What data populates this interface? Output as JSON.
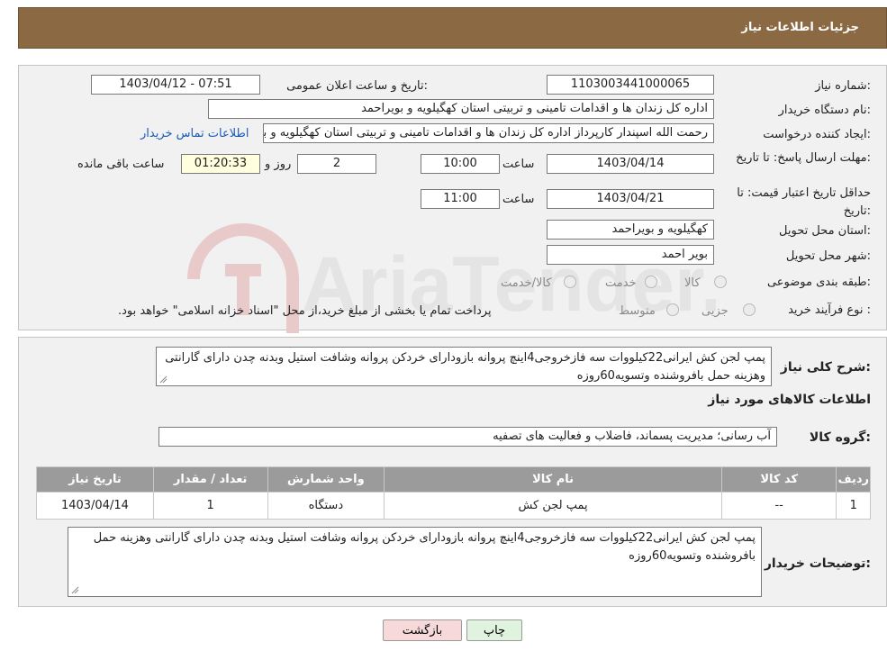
{
  "header": {
    "title": "جزئیات اطلاعات نیاز"
  },
  "form": {
    "need_number_label": "شماره نیاز:",
    "need_number": "1103003441000065",
    "announce_label": "تاریخ و ساعت اعلان عمومی:",
    "announce_value": "1403/04/12 - 07:51",
    "buyer_org_label": "نام دستگاه خریدار:",
    "buyer_org": "اداره کل زندان ها و اقدامات تامینی و تربیتی استان کهگیلویه و بویراحمد",
    "creator_label": "ایجاد کننده درخواست:",
    "creator": "رحمت الله اسپندار کارپرداز اداره کل زندان ها و اقدامات تامینی و تربیتی استان کهگیلویه و بویراحمد",
    "contact_link": "اطلاعات تماس خریدار",
    "deadline_label": "مهلت ارسال پاسخ: تا تاریخ:",
    "deadline_date": "1403/04/14",
    "time_label": "ساعت",
    "deadline_time": "10:00",
    "days_value": "2",
    "days_label": "روز و",
    "remaining_value": "01:20:33",
    "remaining_label": "ساعت باقی مانده",
    "validity_label": "حداقل تاریخ اعتبار قیمت: تا تاریخ:",
    "validity_date": "1403/04/21",
    "validity_time": "11:00",
    "province_label": "استان محل تحویل:",
    "province": "کهگیلویه و بویراحمد",
    "city_label": "شهر محل تحویل:",
    "city": "بویر احمد",
    "category_label": "طبقه بندی موضوعی:",
    "category_options": [
      "کالا",
      "خدمت",
      "کالا/خدمت"
    ],
    "process_label": "نوع فرآیند خرید :",
    "process_options": [
      "جزیی",
      "متوسط"
    ],
    "process_note": "پرداخت تمام یا بخشی از مبلغ خرید،از محل \"اسناد خزانه اسلامی\" خواهد بود."
  },
  "watermark": {
    "text": "AriaTender.neT"
  },
  "description": {
    "label": "شرح کلی نیاز:",
    "text": "پمپ لجن کش ایرانی22کیلووات سه فازخروجی4اینچ پروانه بازودارای خردکن پروانه وشافت استیل وبدنه چدن دارای گارانتی وهزینه حمل بافروشنده وتسویه60روزه"
  },
  "goods": {
    "section_title": "اطلاعات کالاهای مورد نیاز",
    "group_label": "گروه کالا:",
    "group_value": "آب رسانی؛ مدیریت پسماند، فاضلاب و فعالیت های تصفیه",
    "columns": [
      "ردیف",
      "کد کالا",
      "نام کالا",
      "واحد شمارش",
      "تعداد / مقدار",
      "تاریخ نیاز"
    ],
    "rows": [
      [
        "1",
        "--",
        "پمپ لجن کش",
        "دستگاه",
        "1",
        "1403/04/14"
      ]
    ]
  },
  "buyer_notes": {
    "label": "توضیحات خریدار:",
    "text": "پمپ لجن کش ایرانی22کیلووات سه فازخروجی4اینچ پروانه بازودارای خردکن پروانه وشافت استیل وبدنه چدن دارای گارانتی وهزینه حمل بافروشنده وتسویه60روزه"
  },
  "buttons": {
    "print": "چاپ",
    "back": "بازگشت"
  },
  "colors": {
    "header_bg": "#8b6a43",
    "table_header_bg": "#9b9b9b",
    "back_button_bg": "#f7d9d9",
    "print_button_bg": "#dff3df"
  }
}
